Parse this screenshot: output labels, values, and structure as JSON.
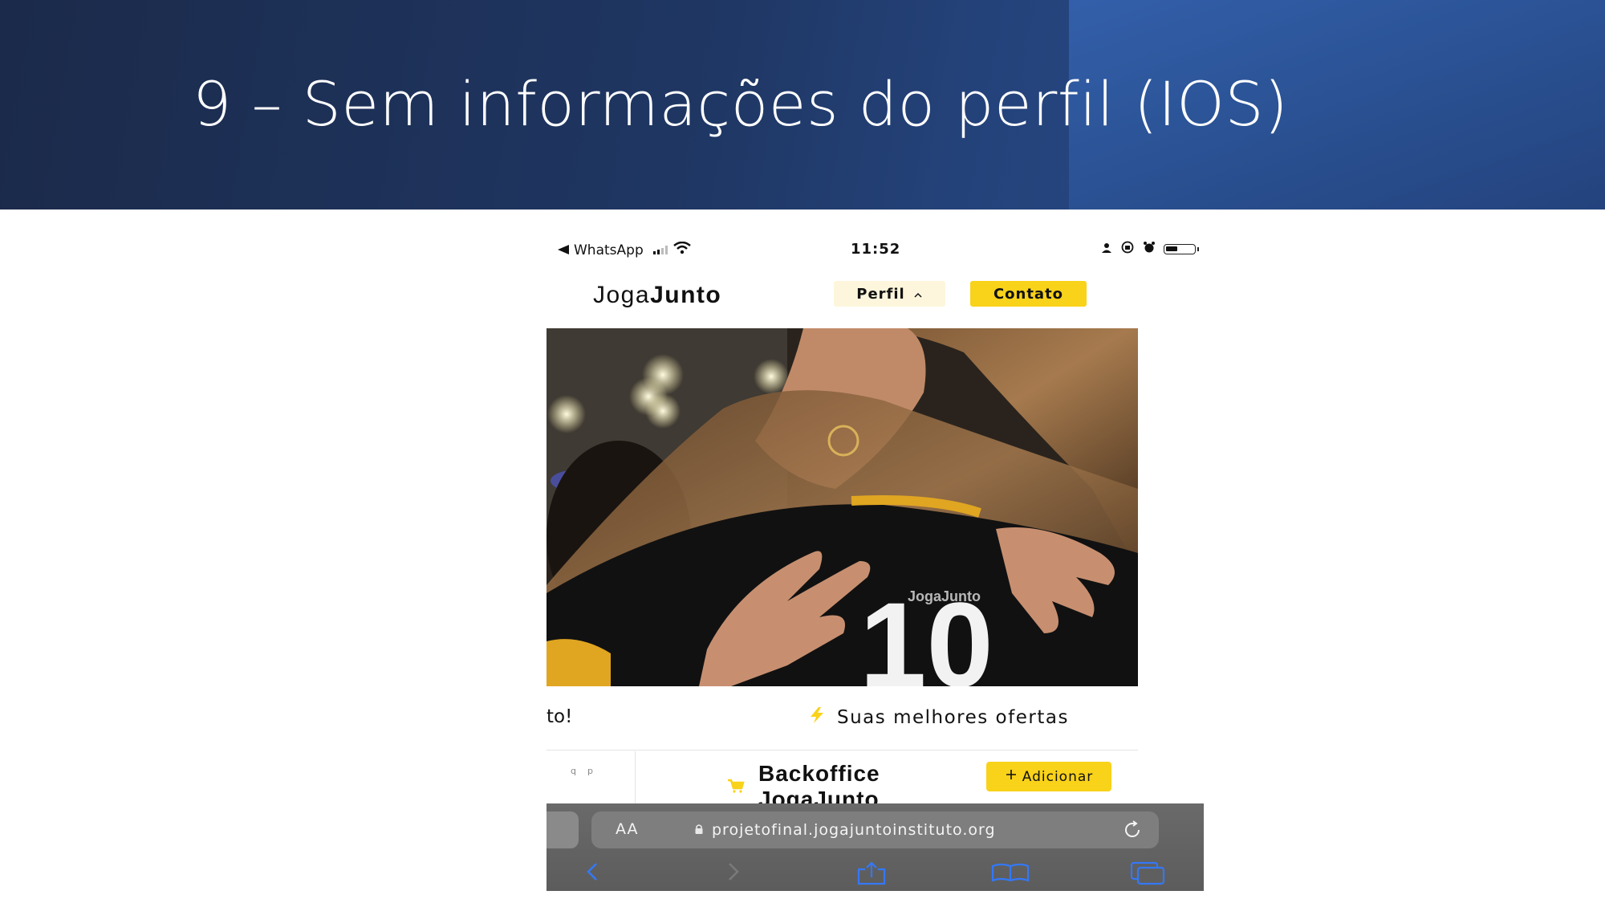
{
  "slide": {
    "title": "9 – Sem informações do perfil (IOS)"
  },
  "status_bar": {
    "back_app": "WhatsApp",
    "time": "11:52",
    "battery_level": 0.4
  },
  "nav": {
    "logo_light": "Joga",
    "logo_bold": "Junto",
    "perfil_label": "Perfil",
    "contato_label": "Contato"
  },
  "hero": {
    "jersey_text": "JogaJunto",
    "jersey_number": "10"
  },
  "ticker": {
    "left_text": "to!",
    "right_text": "Suas melhores ofertas"
  },
  "page": {
    "mini_search": [
      "q",
      "p"
    ],
    "backoffice_line1": "Backoffice",
    "backoffice_line2": "JogaJunto",
    "add_button": "Adicionar"
  },
  "safari": {
    "text_size_label": "AA",
    "url": "projetofinal.jogajuntoinstituto.org"
  },
  "icons": [
    "back-arrow-icon",
    "wifi-icon",
    "person-icon",
    "lock-rotation-icon",
    "alarm-icon",
    "battery-icon",
    "chevron-up-icon",
    "bolt-icon",
    "cart-icon",
    "plus-icon",
    "padlock-icon",
    "reload-icon",
    "back-icon",
    "forward-icon",
    "share-icon",
    "bookmarks-icon",
    "tabs-icon"
  ],
  "colors": {
    "header_dark": "#1b2a4a",
    "header_accent": "#3461ad",
    "brand_yellow": "#f9d21a",
    "perfil_bg": "#fdf6dc",
    "ios_blue": "#3478f6"
  }
}
